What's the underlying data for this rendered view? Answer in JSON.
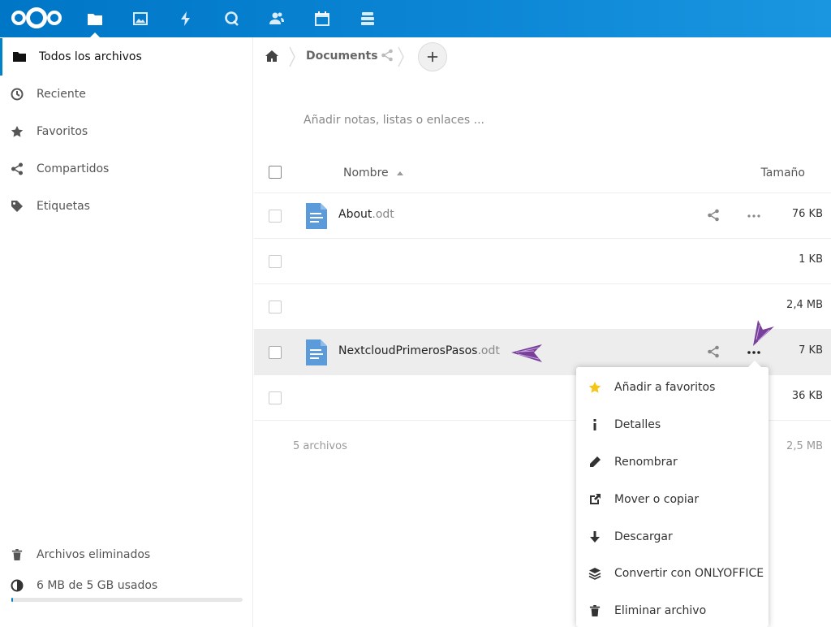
{
  "colors": {
    "header": "#0082c9",
    "accent": "#0082c9",
    "arrow": "#6a2c91",
    "file_icon": "#5b9bd9",
    "star": "#f5c518"
  },
  "header": {
    "logo_icon": "nextcloud-logo",
    "apps": [
      "files-icon",
      "photos-icon",
      "activity-icon",
      "search-icon",
      "contacts-icon",
      "calendar-icon",
      "deck-icon"
    ]
  },
  "sidebar": {
    "items": [
      {
        "label": "Todos los archivos",
        "icon": "folder-icon",
        "active": true
      },
      {
        "label": "Reciente",
        "icon": "clock-icon"
      },
      {
        "label": "Favoritos",
        "icon": "star-icon"
      },
      {
        "label": "Compartidos",
        "icon": "share-icon"
      },
      {
        "label": "Etiquetas",
        "icon": "tag-icon"
      }
    ],
    "deleted_label": "Archivos eliminados",
    "quota_label": "6 MB de 5 GB usados",
    "quota_fraction": 0.0012
  },
  "breadcrumb": {
    "folder": "Documents"
  },
  "notes_placeholder": "Añadir notas, listas o enlaces ...",
  "table": {
    "col_name": "Nombre",
    "col_size": "Tamaño",
    "rows": [
      {
        "name": "About",
        "ext": ".odt",
        "size": "76 KB"
      },
      {
        "name": "",
        "ext": "",
        "size": "1 KB"
      },
      {
        "name": "",
        "ext": "",
        "size": "2,4 MB"
      },
      {
        "name": "NextcloudPrimerosPasos",
        "ext": ".odt",
        "size": "7 KB"
      },
      {
        "name": "",
        "ext": "",
        "size": "36 KB"
      }
    ],
    "footer_count": "5 archivos",
    "footer_size": "2,5 MB"
  },
  "menu": {
    "items": [
      {
        "label": "Añadir a favoritos",
        "icon": "star-icon"
      },
      {
        "label": "Detalles",
        "icon": "info-icon"
      },
      {
        "label": "Renombrar",
        "icon": "pencil-icon"
      },
      {
        "label": "Mover o copiar",
        "icon": "external-link-icon"
      },
      {
        "label": "Descargar",
        "icon": "download-icon"
      },
      {
        "label": "Convertir con ONLYOFFICE",
        "icon": "layers-icon"
      },
      {
        "label": "Eliminar archivo",
        "icon": "trash-icon"
      }
    ]
  }
}
